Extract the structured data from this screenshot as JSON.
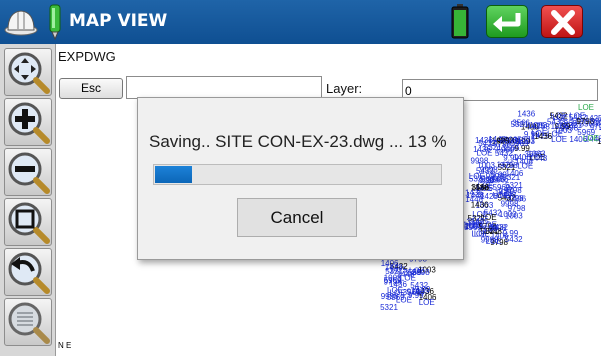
{
  "title_bar": {
    "title": "MAP VIEW",
    "app_icon": "hard-hat-icon",
    "pen_icon": "stylus-icon",
    "battery_icon": "battery-icon",
    "battery_level": 1.0,
    "enter_icon": "enter-return-icon",
    "close_icon": "close-x-icon"
  },
  "toolbar": {
    "tools": [
      {
        "name": "pan-zoom-icon"
      },
      {
        "name": "zoom-in-icon"
      },
      {
        "name": "zoom-out-icon"
      },
      {
        "name": "zoom-window-icon"
      },
      {
        "name": "zoom-previous-icon"
      },
      {
        "name": "zoom-extents-icon"
      }
    ]
  },
  "command": {
    "prompt": "EXPDWG",
    "esc_label": "Esc",
    "input_value": "",
    "layer_label": "Layer:",
    "layer_value": "0"
  },
  "map": {
    "compass_text": "N E",
    "labels": [
      "1003",
      "9798",
      "5321",
      "5432",
      "LOE",
      "LOE",
      "9998",
      "9.99",
      "1406",
      "1425",
      "1436",
      "1448",
      "5969",
      "3566"
    ]
  },
  "dialog": {
    "message": "Saving.. SITE CON-EX-23.dwg ... 13 %",
    "progress": 0.13,
    "cancel_label": "Cancel"
  },
  "colors": {
    "title_bar": "#15599d",
    "progress": "#0f6fc6",
    "map_points": "#1a2bd6",
    "map_labels_alt": "#000000",
    "map_green": "#2aa84a"
  }
}
